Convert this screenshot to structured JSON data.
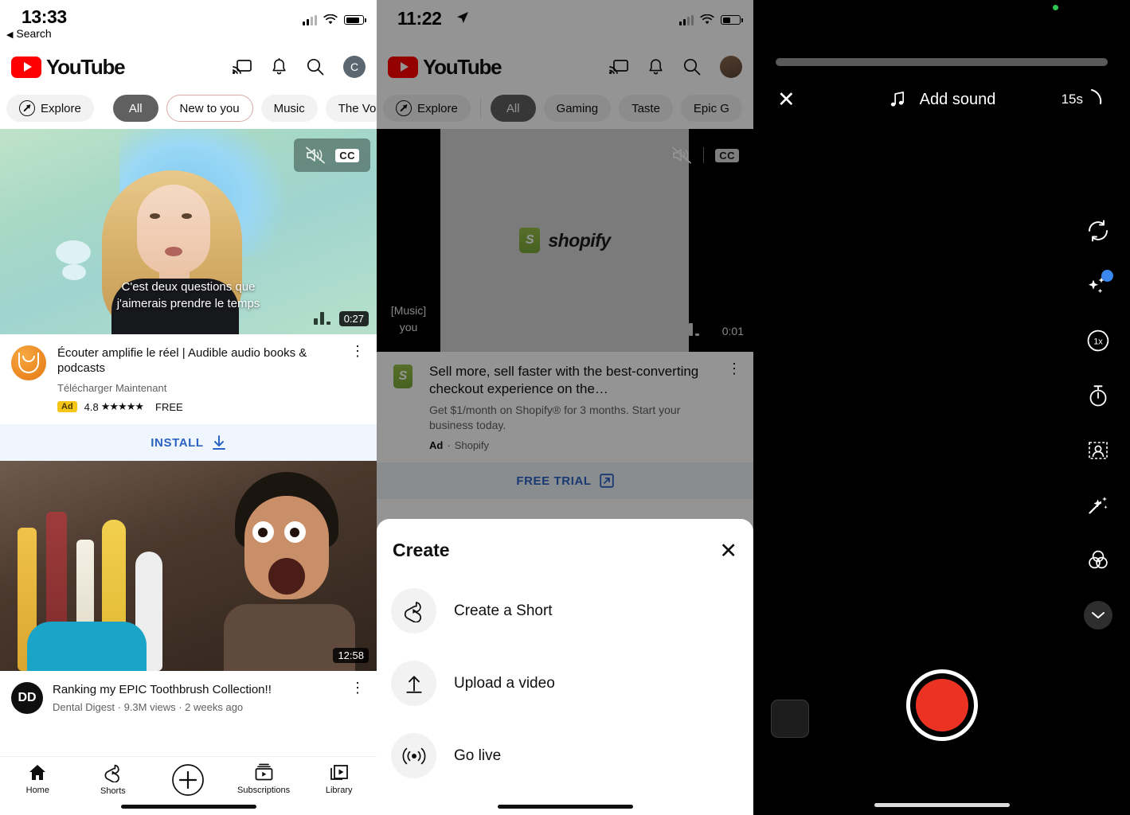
{
  "panel1": {
    "status": {
      "time": "13:33",
      "back_label": "Search",
      "back_arrow": "◀"
    },
    "app": {
      "name": "YouTube",
      "logo_icon": "youtube-logo",
      "avatar_letter": "C"
    },
    "header_icons": [
      "cast-icon",
      "bell-icon",
      "search-icon",
      "avatar"
    ],
    "chips": [
      {
        "label": "Explore",
        "icon": "compass-icon",
        "style": "explore"
      },
      {
        "label": "All",
        "style": "dark"
      },
      {
        "label": "New to you",
        "style": "outline"
      },
      {
        "label": "Music",
        "style": "plain"
      },
      {
        "label": "The Voi",
        "style": "plain"
      }
    ],
    "video1": {
      "caption_line1": "C'est deux questions que",
      "caption_line2": "j'aimerais prendre le temps",
      "duration": "0:27",
      "cc_label": "CC",
      "mute_icon": "mute-icon",
      "stats_icon": "bar-stats-icon"
    },
    "ad": {
      "title": "Écouter amplifie le réel | Audible audio books & podcasts",
      "subtitle": "Télécharger Maintenant",
      "badge": "Ad",
      "rating": "4.8",
      "stars": "★★★★★",
      "price": "FREE",
      "cta": "INSTALL",
      "cta_icon": "download-icon",
      "app_icon": "audible-icon",
      "menu_icon": "kebab-icon"
    },
    "video2": {
      "duration": "12:58",
      "title": "Ranking my EPIC Toothbrush Collection!!",
      "channel_initials": "DD",
      "meta": "Dental Digest · 9.3M views · 2 weeks ago",
      "menu_icon": "kebab-icon"
    },
    "tabs": [
      {
        "label": "Home",
        "icon": "home-icon"
      },
      {
        "label": "Shorts",
        "icon": "shorts-icon"
      },
      {
        "label": "",
        "icon": "plus-circle-icon"
      },
      {
        "label": "Subscriptions",
        "icon": "subscriptions-icon"
      },
      {
        "label": "Library",
        "icon": "library-icon"
      }
    ]
  },
  "panel2": {
    "status": {
      "time": "11:22",
      "location_icon": "location-arrow-icon"
    },
    "app": {
      "name": "YouTube",
      "logo_icon": "youtube-logo"
    },
    "chips": [
      {
        "label": "Explore",
        "icon": "compass-icon",
        "style": "explore"
      },
      {
        "label": "All",
        "style": "dark"
      },
      {
        "label": "Gaming",
        "style": "plain"
      },
      {
        "label": "Taste",
        "style": "plain"
      },
      {
        "label": "Epic G",
        "style": "plain"
      }
    ],
    "video": {
      "brand": "shopify",
      "caption_line1": "[Music]",
      "caption_line2": "you",
      "duration": "0:01",
      "cc_label": "CC",
      "mute_icon": "mute-icon"
    },
    "ad": {
      "title": "Sell more, sell faster with the best-converting checkout experience on the…",
      "subtitle": "Get $1/month on Shopify® for 3 months. Start your business today.",
      "badge": "Ad",
      "advertiser": "Shopify",
      "separator": "·",
      "cta": "FREE TRIAL",
      "cta_icon": "external-link-icon",
      "menu_icon": "kebab-icon"
    },
    "sheet": {
      "title": "Create",
      "close_icon": "close-icon",
      "items": [
        {
          "label": "Create a Short",
          "icon": "shorts-icon"
        },
        {
          "label": "Upload a video",
          "icon": "upload-icon"
        },
        {
          "label": "Go live",
          "icon": "broadcast-icon"
        }
      ]
    }
  },
  "panel3": {
    "top": {
      "close_icon": "close-icon",
      "sound_label": "Add sound",
      "sound_icon": "music-note-icon",
      "duration_label": "15s",
      "duration_arc_icon": "arc-icon",
      "privacy_indicator": "green-camera-dot"
    },
    "sidebar": [
      {
        "name": "flip-camera-icon",
        "badge": false
      },
      {
        "name": "effects-icon",
        "badge": true
      },
      {
        "name": "speed-1x-icon",
        "badge": false,
        "label": "1x"
      },
      {
        "name": "timer-icon",
        "badge": false
      },
      {
        "name": "green-screen-icon",
        "badge": false
      },
      {
        "name": "retouch-wand-icon",
        "badge": false
      },
      {
        "name": "filters-icon",
        "badge": false
      },
      {
        "name": "collapse-chevron-down-icon",
        "badge": false
      }
    ],
    "bottom": {
      "gallery_icon": "gallery-thumbnail",
      "record_button": "record-button"
    },
    "colors": {
      "record": "#ec3323",
      "badge": "#3b87f0",
      "privacy": "#30c552"
    }
  }
}
